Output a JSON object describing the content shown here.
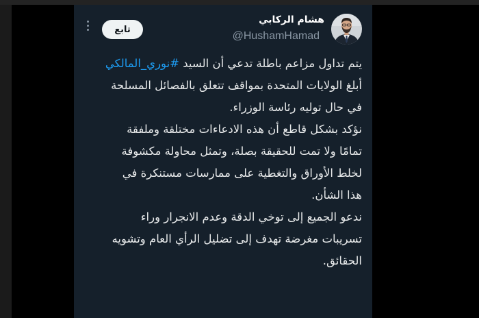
{
  "colors": {
    "card_bg": "#15202b",
    "text": "#e7e9ea",
    "secondary_text": "#8b98a5",
    "hashtag": "#1d9bf0",
    "follow_bg": "#eff3f4"
  },
  "author": {
    "name": "هشام الركابي",
    "handle": "@HushamHamad",
    "avatar_icon": "profile-photo"
  },
  "actions": {
    "follow_label": "تابع",
    "more_icon": "more-vertical-icon"
  },
  "tweet": {
    "line1_text": "يتم تداول مزاعم باطلة تدعي أن السيد ",
    "line1_hashtag": "#نوري_المالكي",
    "lines": [
      "أبلغ الولايات المتحدة بمواقف تتعلق بالفصائل المسلحة",
      "في حال توليه رئاسة الوزراء.",
      "نؤكد بشكل قاطع أن هذه الادعاءات مختلقة وملفقة",
      "تمامًا ولا تمت للحقيقة بصلة، وتمثل محاولة مكشوفة",
      "لخلط الأوراق والتغطية على ممارسات مستنكرة في",
      "هذا الشأن.",
      "ندعو الجميع إلى توخي الدقة وعدم الانجرار وراء",
      "تسريبات مغرضة تهدف إلى تضليل الرأي العام وتشويه",
      "الحقائق."
    ]
  }
}
